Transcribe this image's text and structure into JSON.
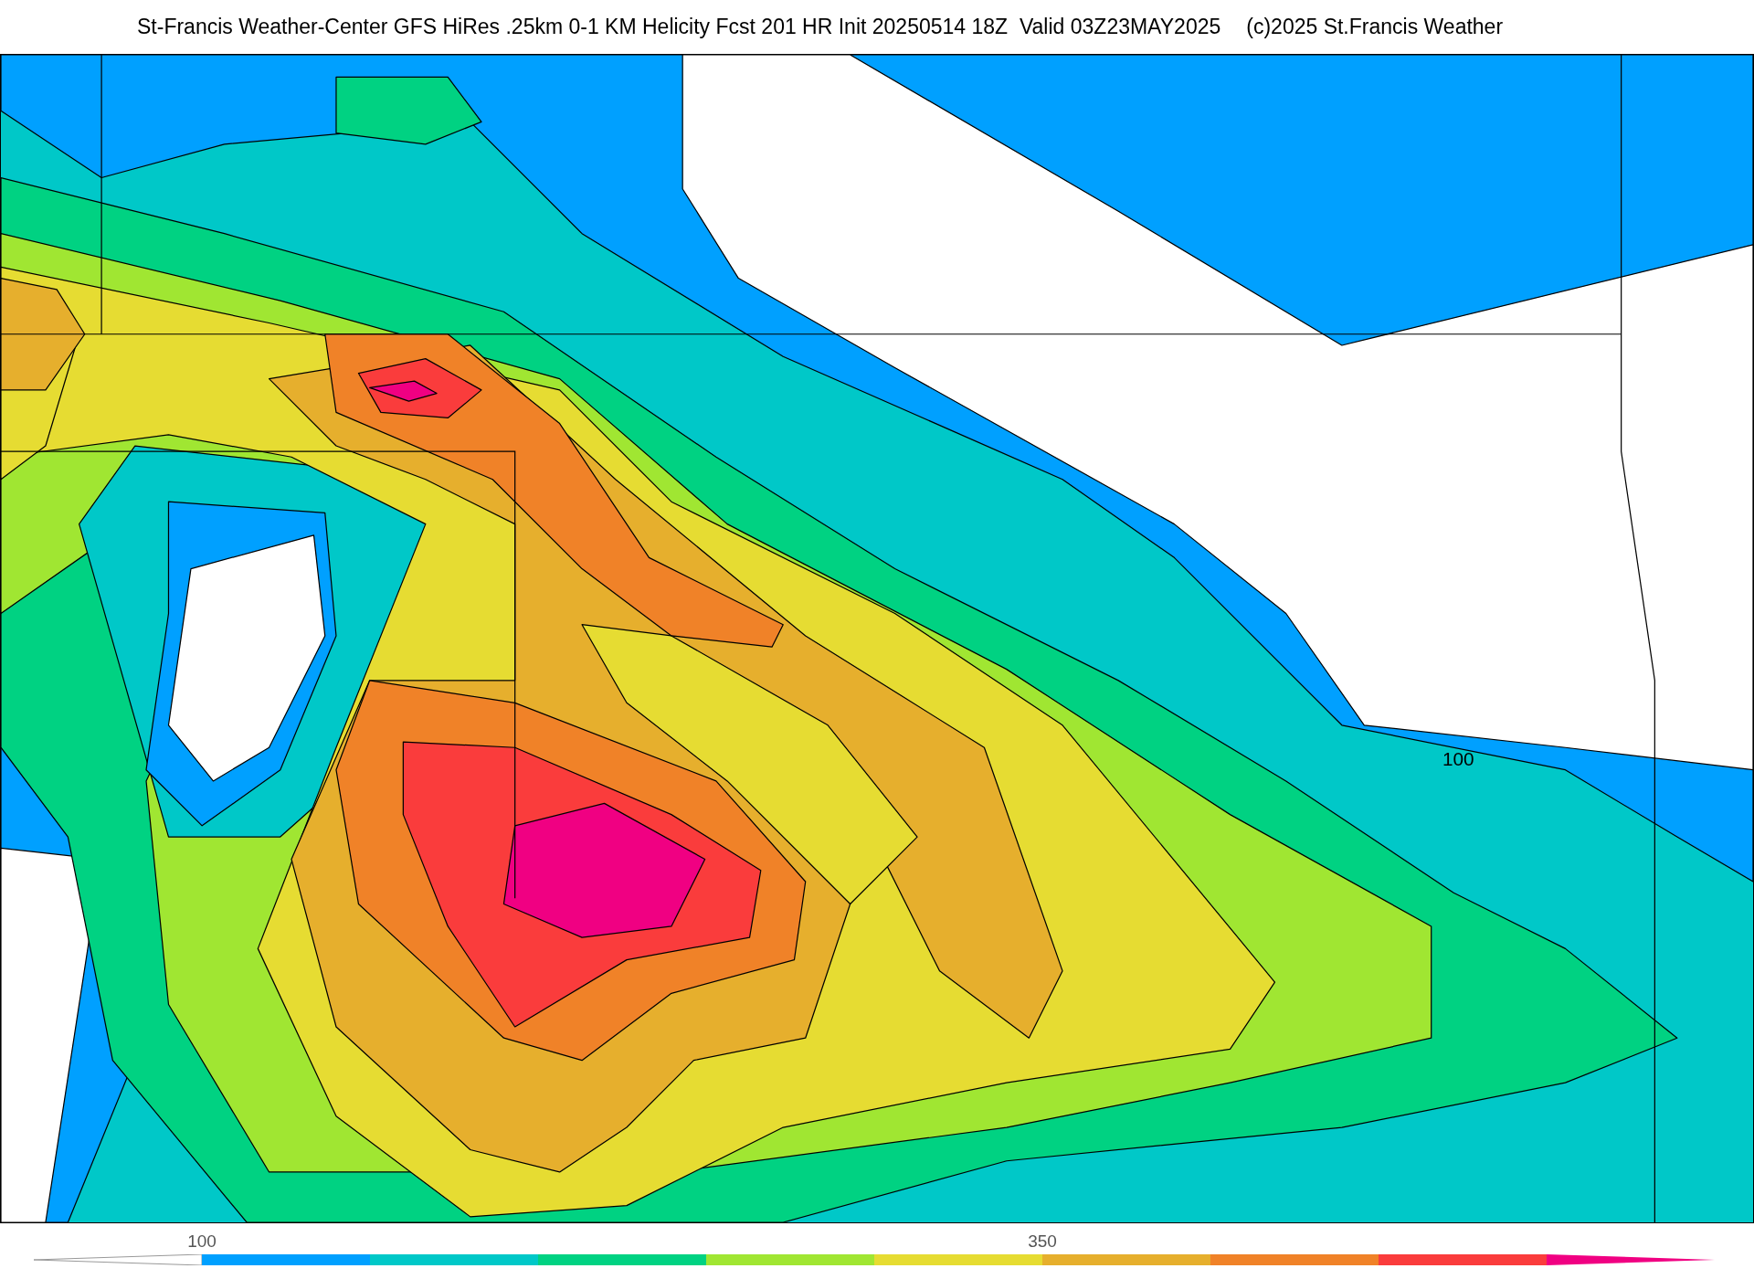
{
  "title": {
    "main": "St-Francis Weather-Center GFS HiRes .25km 0-1 KM Helicity Fcst 201 HR Init 20250514 18Z  Valid 03Z23MAY2025",
    "credit": "(c)2025 St.Francis Weather"
  },
  "map": {
    "contour_label": "100"
  },
  "colorbar": {
    "segments": [
      {
        "kind": "triangle",
        "color": "#ffffff"
      },
      {
        "kind": "box",
        "color": "#00a0ff",
        "label": "100"
      },
      {
        "kind": "box",
        "color": "#00c8c8"
      },
      {
        "kind": "box",
        "color": "#00d282"
      },
      {
        "kind": "box",
        "color": "#a0e632"
      },
      {
        "kind": "box",
        "color": "#e6dc32"
      },
      {
        "kind": "box",
        "color": "#e6af2d",
        "label": "350"
      },
      {
        "kind": "box",
        "color": "#f08228"
      },
      {
        "kind": "box",
        "color": "#fa3c3c"
      },
      {
        "kind": "triangle",
        "color": "#f00082"
      }
    ]
  }
}
